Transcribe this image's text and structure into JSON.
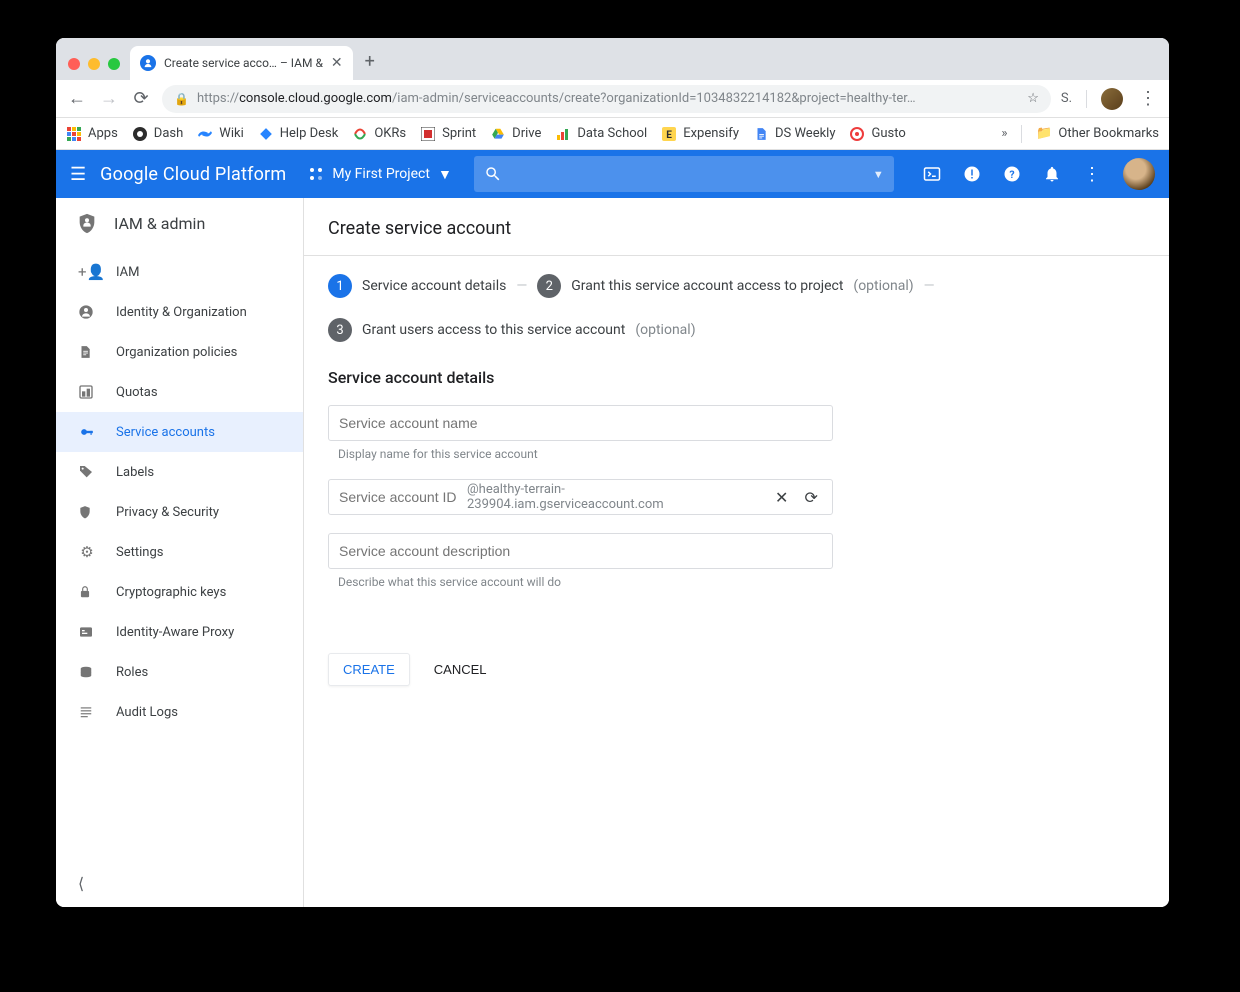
{
  "browser": {
    "tab_title": "Create service acco… – IAM &",
    "url_prefix": "https://",
    "url_host": "console.cloud.google.com",
    "url_path": "/iam-admin/serviceaccounts/create?organizationId=1034832214182&project=healthy-ter…",
    "profile_letter": "S.",
    "bookmarks": [
      {
        "label": "Apps",
        "icon": "apps"
      },
      {
        "label": "Dash",
        "icon": "circle-dark"
      },
      {
        "label": "Wiki",
        "icon": "confluence"
      },
      {
        "label": "Help Desk",
        "icon": "jira"
      },
      {
        "label": "OKRs",
        "icon": "okr"
      },
      {
        "label": "Sprint",
        "icon": "sprint"
      },
      {
        "label": "Drive",
        "icon": "drive"
      },
      {
        "label": "Data School",
        "icon": "ds"
      },
      {
        "label": "Expensify",
        "icon": "expensify"
      },
      {
        "label": "DS Weekly",
        "icon": "docs"
      },
      {
        "label": "Gusto",
        "icon": "gusto"
      }
    ],
    "other_bookmarks": "Other Bookmarks"
  },
  "gcp": {
    "logo_prefix": "Google ",
    "logo_suffix": "Cloud Platform",
    "project": "My First Project"
  },
  "sidebar": {
    "title": "IAM & admin",
    "items": [
      {
        "label": "IAM",
        "icon": "person-add"
      },
      {
        "label": "Identity & Organization",
        "icon": "account-circle"
      },
      {
        "label": "Organization policies",
        "icon": "doc"
      },
      {
        "label": "Quotas",
        "icon": "quota"
      },
      {
        "label": "Service accounts",
        "icon": "key",
        "active": true
      },
      {
        "label": "Labels",
        "icon": "tag"
      },
      {
        "label": "Privacy & Security",
        "icon": "shield"
      },
      {
        "label": "Settings",
        "icon": "gear"
      },
      {
        "label": "Cryptographic keys",
        "icon": "lock"
      },
      {
        "label": "Identity-Aware Proxy",
        "icon": "iap"
      },
      {
        "label": "Roles",
        "icon": "roles"
      },
      {
        "label": "Audit Logs",
        "icon": "list"
      }
    ]
  },
  "page": {
    "title": "Create service account",
    "steps": {
      "s1": "Service account details",
      "s2": "Grant this service account access to project",
      "s2_opt": "(optional)",
      "s3": "Grant users access to this service account",
      "s3_opt": "(optional)"
    },
    "form": {
      "section_title": "Service account details",
      "name_placeholder": "Service account name",
      "name_hint": "Display name for this service account",
      "id_placeholder": "Service account ID",
      "id_suffix": "@healthy-terrain-239904.iam.gserviceaccount.com",
      "desc_placeholder": "Service account description",
      "desc_hint": "Describe what this service account will do"
    },
    "buttons": {
      "create": "CREATE",
      "cancel": "CANCEL"
    }
  }
}
